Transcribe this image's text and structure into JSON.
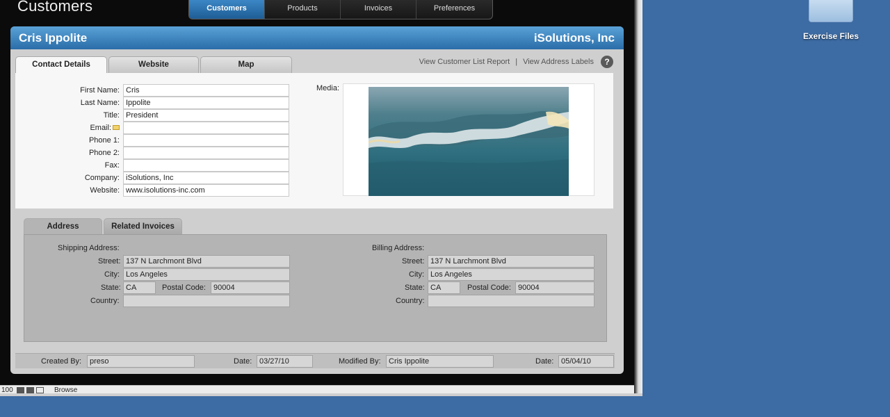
{
  "desktop": {
    "folder_label": "Exercise Files"
  },
  "app": {
    "title": "Customers",
    "nav": [
      "Customers",
      "Products",
      "Invoices",
      "Preferences"
    ]
  },
  "record": {
    "name": "Cris Ippolite",
    "company_name": "iSolutions, Inc"
  },
  "tabs": [
    "Contact Details",
    "Website",
    "Map"
  ],
  "links": {
    "report": "View Customer List Report",
    "separator": "|",
    "labels": "View Address Labels",
    "help": "?"
  },
  "contact": {
    "first_name": {
      "label": "First Name:",
      "value": "Cris"
    },
    "last_name": {
      "label": "Last Name:",
      "value": "Ippolite"
    },
    "title": {
      "label": "Title:",
      "value": "President"
    },
    "email": {
      "label": "Email:",
      "value": ""
    },
    "phone1": {
      "label": "Phone 1:",
      "value": ""
    },
    "phone2": {
      "label": "Phone 2:",
      "value": ""
    },
    "fax": {
      "label": "Fax:",
      "value": ""
    },
    "company": {
      "label": "Company:",
      "value": "iSolutions, Inc"
    },
    "website": {
      "label": "Website:",
      "value": "www.isolutions-inc.com"
    },
    "media_label": "Media:"
  },
  "lower_tabs": [
    "Address",
    "Related Invoices"
  ],
  "shipping": {
    "heading": "Shipping Address:",
    "street_label": "Street:",
    "street": "137 N Larchmont Blvd",
    "city_label": "City:",
    "city": "Los Angeles",
    "state_label": "State:",
    "state": "CA",
    "postal_label": "Postal Code:",
    "postal": "90004",
    "country_label": "Country:",
    "country": ""
  },
  "billing": {
    "heading": "Billing Address:",
    "street_label": "Street:",
    "street": "137 N Larchmont Blvd",
    "city_label": "City:",
    "city": "Los Angeles",
    "state_label": "State:",
    "state": "CA",
    "postal_label": "Postal Code:",
    "postal": "90004",
    "country_label": "Country:",
    "country": ""
  },
  "footer": {
    "created_by_label": "Created By:",
    "created_by": "preso",
    "date1_label": "Date:",
    "date1": "03/27/10",
    "modified_by_label": "Modified By:",
    "modified_by": "Cris Ippolite",
    "date2_label": "Date:",
    "date2": "05/04/10"
  },
  "status": {
    "zoom": "100",
    "mode": "Browse"
  }
}
